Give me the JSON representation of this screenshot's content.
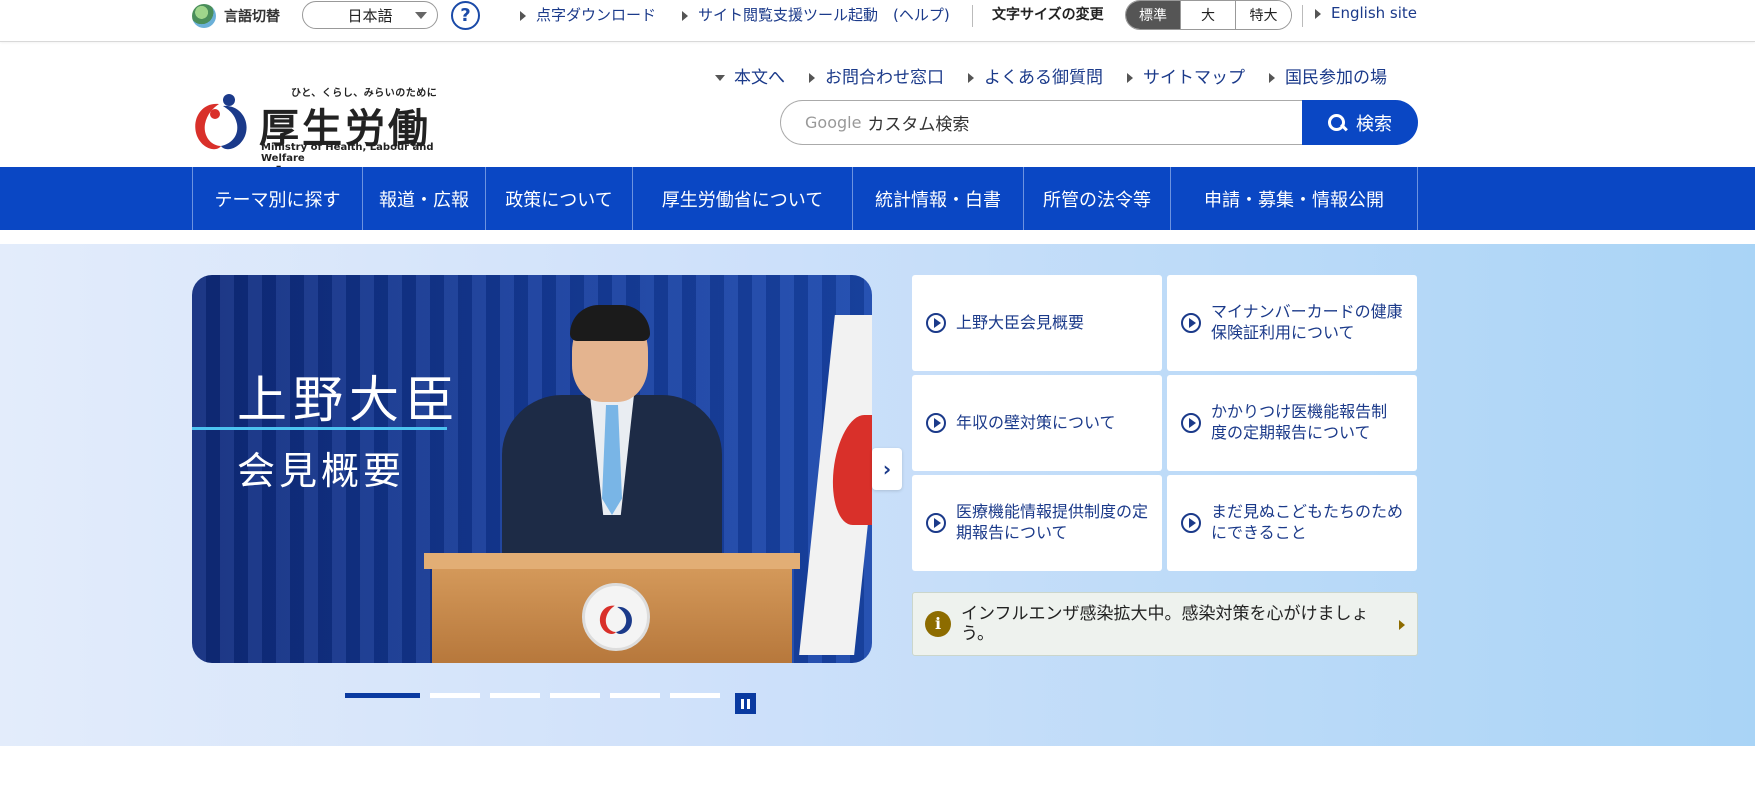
{
  "utility": {
    "lang_label": "言語切替",
    "lang_value": "日本語",
    "help": "?",
    "links": [
      "点字ダウンロード",
      "サイト閲覧支援ツール起動　(ヘルプ)"
    ],
    "size_label": "文字サイズの変更",
    "sizes": [
      "標準",
      "大",
      "特大"
    ],
    "english": "English site"
  },
  "logo": {
    "tagline": "ひと、くらし、みらいのために",
    "name": "厚生労働省",
    "en": "Ministry of Health, Labour and Welfare"
  },
  "header": {
    "links": [
      "本文へ",
      "お問合わせ窓口",
      "よくある御質問",
      "サイトマップ",
      "国民参加の場"
    ]
  },
  "search": {
    "google": "Google",
    "placeholder": "カスタム検索",
    "button": "検索"
  },
  "nav": [
    "テーマ別に探す",
    "報道・広報",
    "政策について",
    "厚生労働省について",
    "統計情報・白書",
    "所管の法令等",
    "申請・募集・情報公開"
  ],
  "banner": {
    "title1": "上野大臣",
    "title2": "会見概要"
  },
  "tiles": [
    "上野大臣会見概要",
    "マイナンバーカードの健康保険証利用について",
    "年収の壁対策について",
    "かかりつけ医機能報告制度の定期報告について",
    "医療機能情報提供制度の定期報告について",
    "まだ見ぬこどもたちのためにできること"
  ],
  "notice": "インフルエンザ感染拡大中。感染対策を心がけましょう。",
  "colors": {
    "brand": "#0a47c4",
    "link": "#1b3a8a",
    "notice_icon": "#8d6c00"
  }
}
